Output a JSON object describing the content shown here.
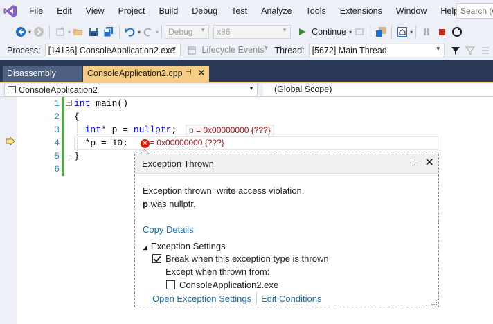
{
  "menu": {
    "items": [
      "File",
      "Edit",
      "View",
      "Project",
      "Build",
      "Debug",
      "Test",
      "Analyze",
      "Tools",
      "Extensions",
      "Window",
      "Help"
    ],
    "search_placeholder": "Search (C"
  },
  "toolbar": {
    "config": "Debug",
    "platform": "x86",
    "continue_label": "Continue"
  },
  "location_bar": {
    "process_label": "Process:",
    "process_value": "[14136] ConsoleApplication2.exe",
    "lifecycle_label": "Lifecycle Events",
    "thread_label": "Thread:",
    "thread_value": "[5672] Main Thread"
  },
  "tabs": [
    {
      "label": "Disassembly",
      "active": false
    },
    {
      "label": "ConsoleApplication2.cpp",
      "active": true
    }
  ],
  "navbar": {
    "project": "ConsoleApplication2",
    "scope": "(Global Scope)"
  },
  "editor": {
    "line_numbers": [
      "1",
      "2",
      "3",
      "4",
      "5",
      "6"
    ],
    "datatip_line3": {
      "name": "p",
      "value": "= 0x00000000 {???}"
    },
    "datatip_line4": {
      "value": "= 0x00000000 {???}"
    }
  },
  "exception": {
    "title": "Exception Thrown",
    "message_line1": "Exception thrown: write access violation.",
    "message_bold": "p",
    "message_rest": " was nullptr.",
    "copy_details": "Copy Details",
    "settings_header": "Exception Settings",
    "break_when_thrown": "Break when this exception type is thrown",
    "break_checked": true,
    "except_when": "Except when thrown from:",
    "module_name": "ConsoleApplication2.exe",
    "module_checked": false,
    "open_settings_link": "Open Exception Settings",
    "edit_conditions_link": "Edit Conditions"
  },
  "colors": {
    "accent_tab": "#f5cc84",
    "tab_band": "#293955",
    "keyword": "#0000ff",
    "line_number": "#2b91af",
    "change_bar": "#57a64a",
    "error": "#e51400",
    "link": "#0e70c0"
  }
}
